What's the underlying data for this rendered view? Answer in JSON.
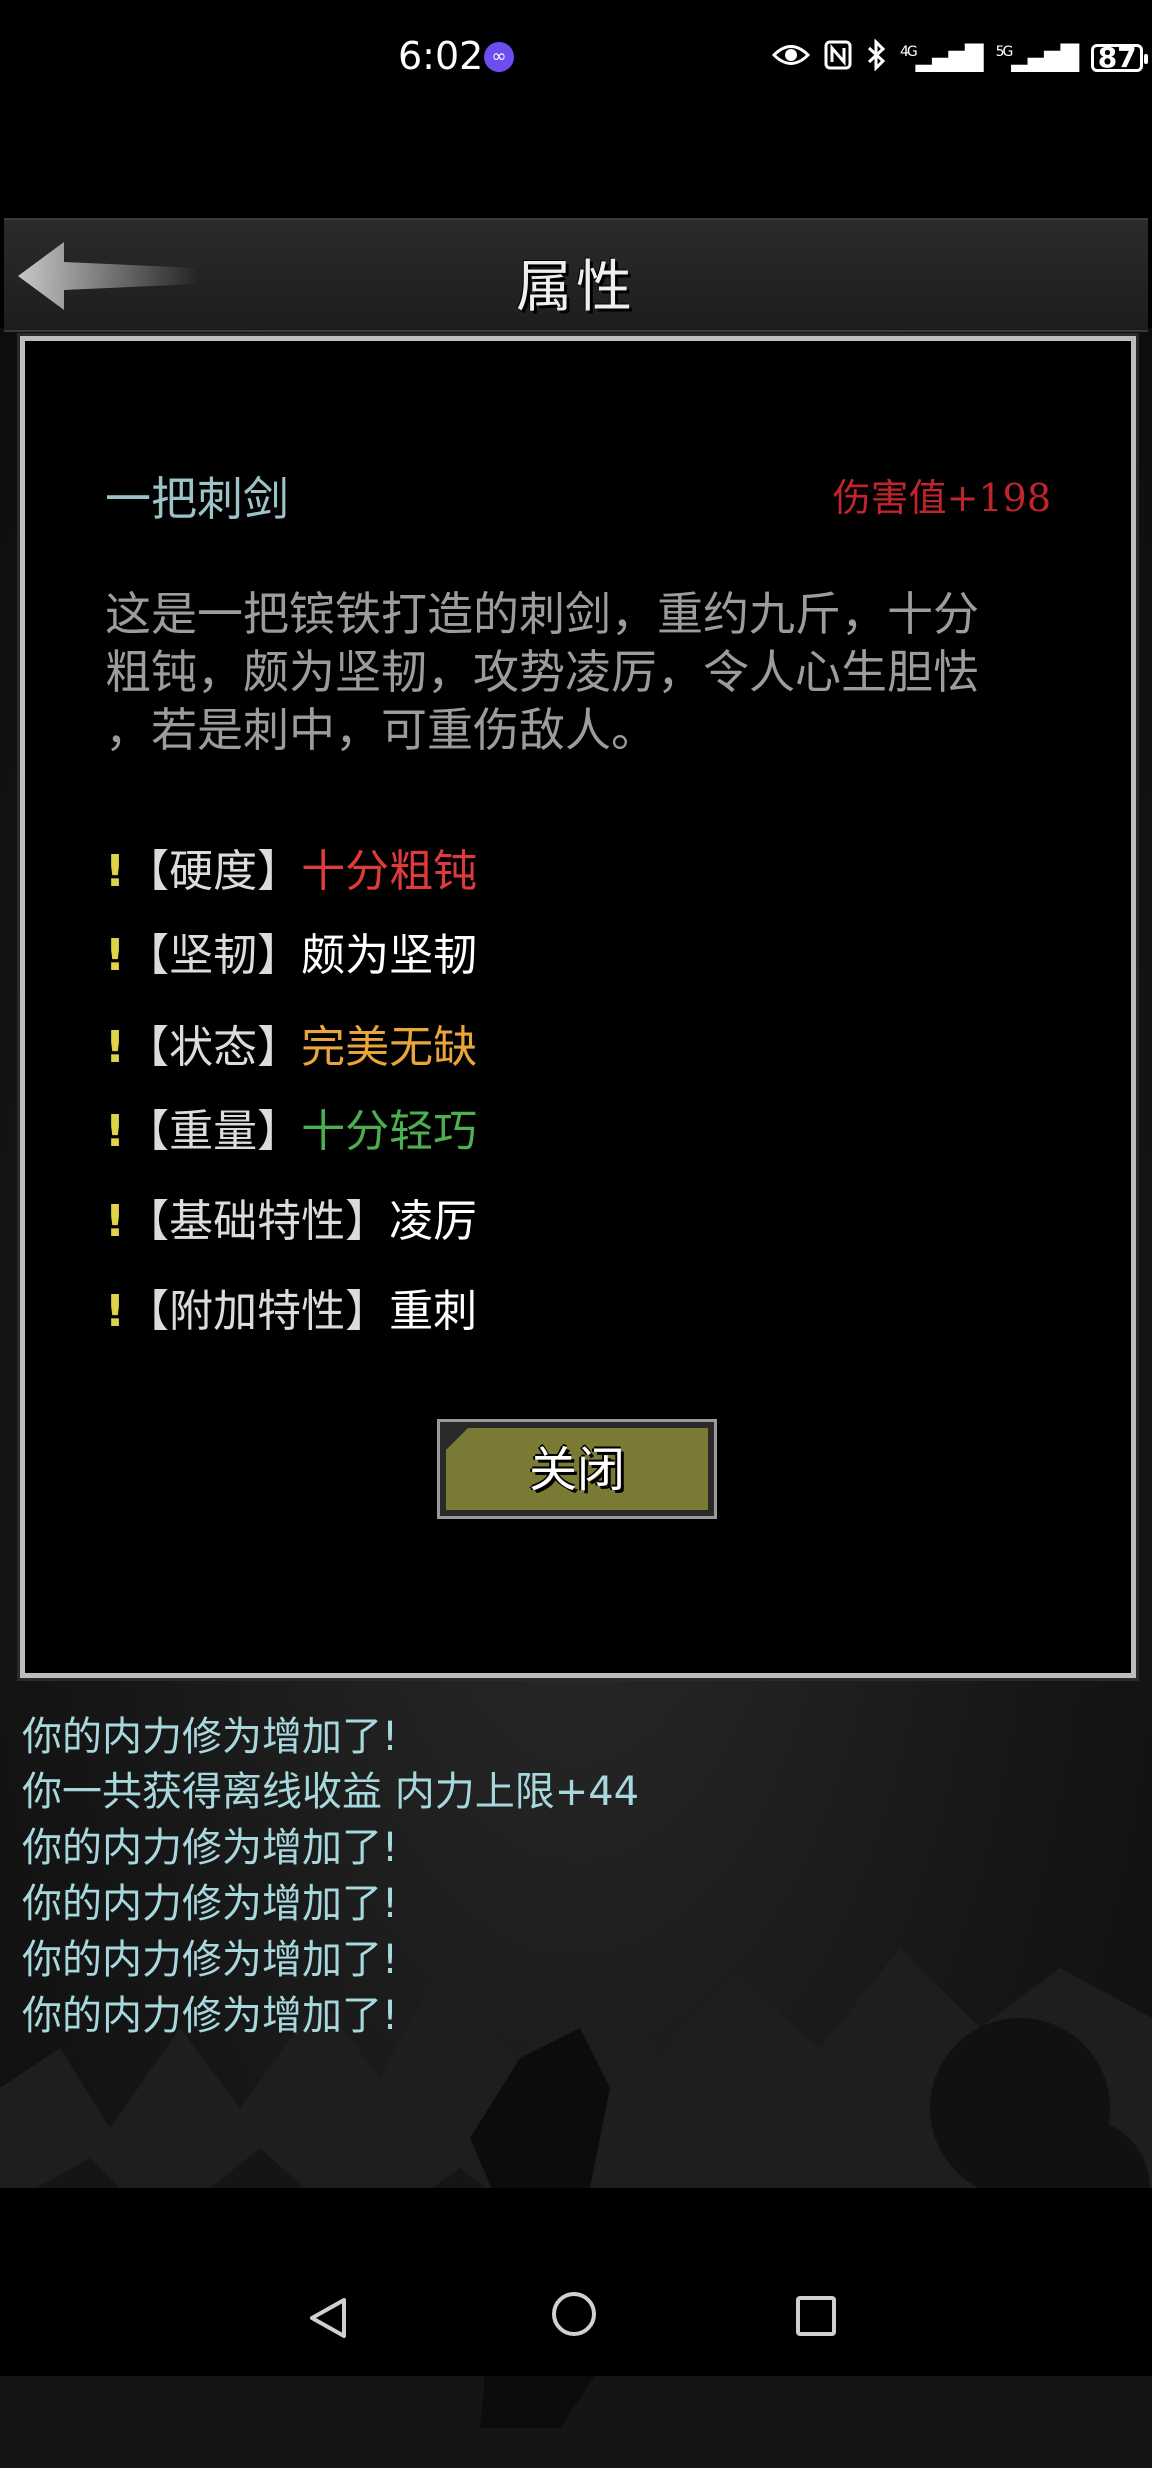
{
  "status_bar": {
    "time": "6:02",
    "battery": "87",
    "network_4g": "4G",
    "network_5g": "5G",
    "icons": [
      "eye-icon",
      "nfc-icon",
      "bluetooth-icon",
      "signal-4g-icon",
      "signal-5g-icon",
      "battery-icon"
    ]
  },
  "header": {
    "title": "属性",
    "back_icon": "back-arrow-icon"
  },
  "item": {
    "name": "一把刺剑",
    "damage": "伤害值+198",
    "description": "这是一把镔铁打造的刺剑，重约九斤，十分粗钝，颇为坚韧，攻势凌厉，令人心生胆怯，若是刺中，可重伤敌人。",
    "description_lines": [
      "这是一把镔铁打造的刺剑，重约九斤，十分",
      "粗钝，颇为坚韧，攻势凌厉，令人心生胆怯",
      "，若是刺中，可重伤敌人。"
    ],
    "attributes": [
      {
        "mark": "!",
        "key": "【硬度】",
        "value": "十分粗钝",
        "color": "#e03a3a"
      },
      {
        "mark": "!",
        "key": "【坚韧】",
        "value": "颇为坚韧",
        "color": "#ffffff"
      },
      {
        "mark": "!",
        "key": "【状态】",
        "value": "完美无缺",
        "color": "#e7a53a"
      },
      {
        "mark": "!",
        "key": "【重量】",
        "value": "十分轻巧",
        "color": "#4caf50"
      },
      {
        "mark": "!",
        "key": "【基础特性】",
        "value": "凌厉",
        "color": "#ffffff"
      },
      {
        "mark": "!",
        "key": "【附加特性】",
        "value": "重刺",
        "color": "#ffffff"
      }
    ],
    "close_label": "关闭"
  },
  "log": [
    "你的内力修为增加了!",
    "你一共获得离线收益 内力上限+44",
    "你的内力修为增加了!",
    "你的内力修为增加了!",
    "你的内力修为增加了!",
    "你的内力修为增加了!"
  ],
  "nav": {
    "icons": [
      "nav-back-icon",
      "nav-home-icon",
      "nav-recents-icon"
    ]
  },
  "colors": {
    "item_name": "#9cc3c7",
    "damage": "#c0252b",
    "log_text": "#a7d8dd",
    "exclamation": "#e0d34a",
    "close_button": "#7b7a35"
  }
}
